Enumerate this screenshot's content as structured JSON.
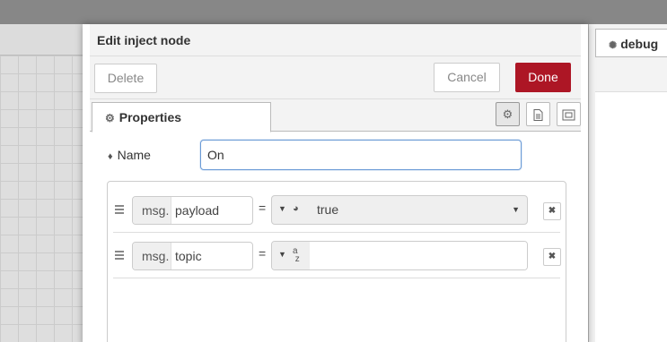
{
  "dialog": {
    "title": "Edit inject node",
    "delete_label": "Delete",
    "cancel_label": "Cancel",
    "done_label": "Done",
    "accent": "#ad1625"
  },
  "tabs": {
    "properties_label": "Properties"
  },
  "form": {
    "name_label": "Name",
    "name_value": "On"
  },
  "props": [
    {
      "prefix": "msg.",
      "key": "payload",
      "type_icon": "bool-icon",
      "value": "true"
    },
    {
      "prefix": "msg.",
      "key": "topic",
      "type_icon": "string-az-icon",
      "value": ""
    }
  ],
  "sidebar": {
    "tab_label": "debug"
  }
}
